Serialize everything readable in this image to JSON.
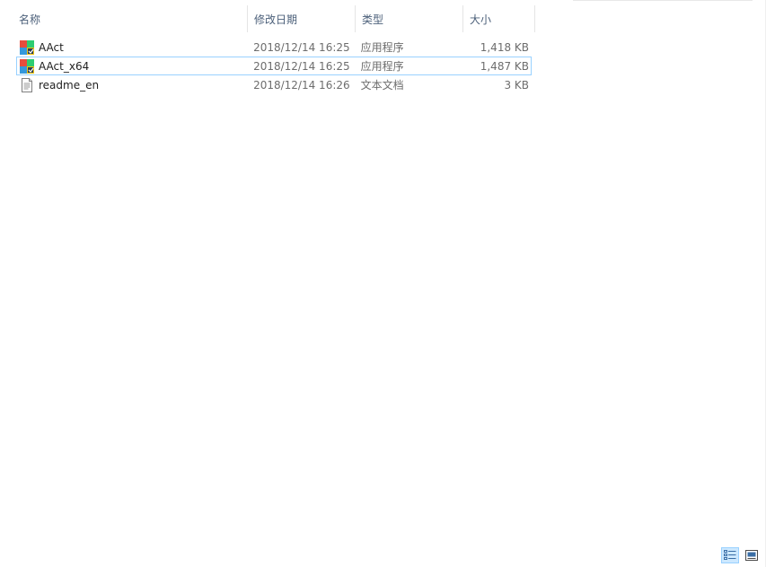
{
  "columns": {
    "name": "名称",
    "date": "修改日期",
    "type": "类型",
    "size": "大小",
    "sort_indicator": "^"
  },
  "files": [
    {
      "name": "AAct",
      "date": "2018/12/14 16:25",
      "type": "应用程序",
      "size": "1,418 KB",
      "icon": "application-icon",
      "selected": false
    },
    {
      "name": "AAct_x64",
      "date": "2018/12/14 16:25",
      "type": "应用程序",
      "size": "1,487 KB",
      "icon": "application-icon",
      "selected": true
    },
    {
      "name": "readme_en",
      "date": "2018/12/14 16:26",
      "type": "文本文档",
      "size": "3 KB",
      "icon": "text-document-icon",
      "selected": false
    }
  ],
  "status_bar": {
    "views": [
      {
        "icon": "details-view-icon",
        "active": true
      },
      {
        "icon": "large-icons-view-icon",
        "active": false
      }
    ]
  },
  "colors": {
    "selection_border": "#99d1ff",
    "header_text": "#4c607a",
    "detail_text": "#6d6d6d"
  }
}
